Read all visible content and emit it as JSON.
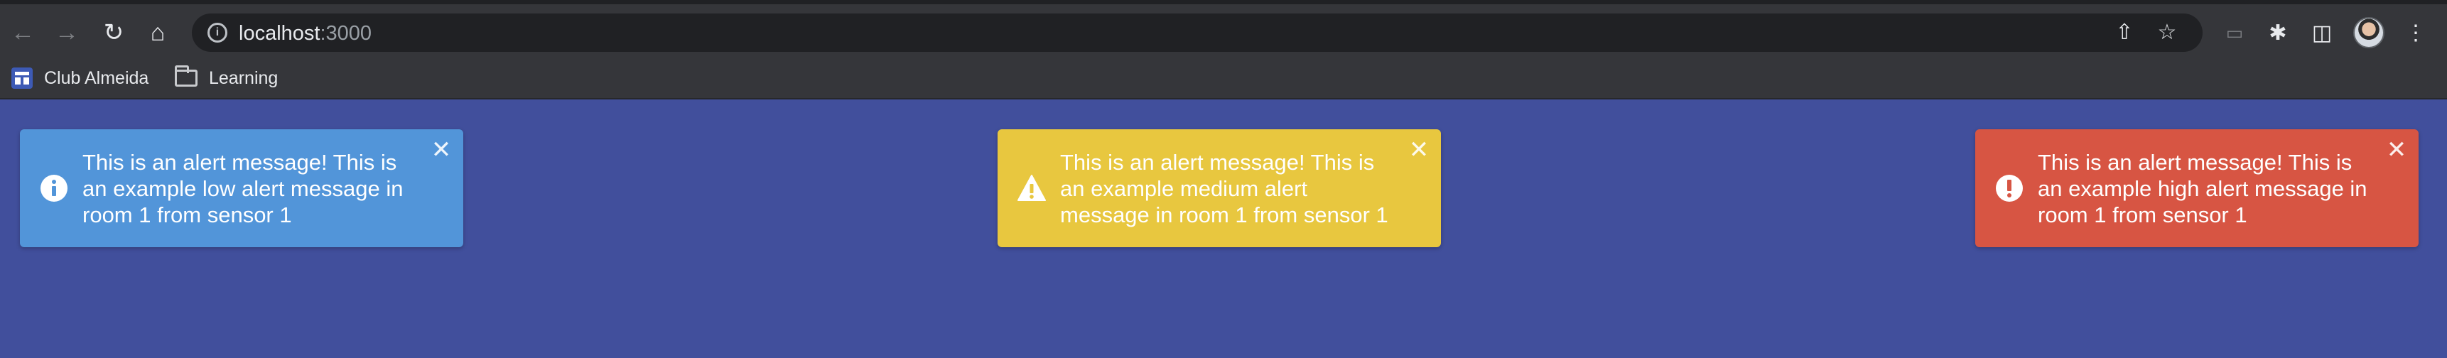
{
  "browser": {
    "url_host": "localhost",
    "url_port": ":3000",
    "bookmarks": [
      {
        "label": "Club Almeida"
      },
      {
        "label": "Learning"
      }
    ]
  },
  "alerts": [
    {
      "level": "low",
      "color": "#5295d9",
      "icon": "info-icon",
      "message": "This is an alert message! This is an example low alert message in room 1 from sensor 1",
      "close": "✕"
    },
    {
      "level": "medium",
      "color": "#e8c73f",
      "icon": "warning-icon",
      "message": "This is an alert message! This is an example medium alert message in room 1 from sensor 1",
      "close": "✕"
    },
    {
      "level": "high",
      "color": "#d75543",
      "icon": "error-icon",
      "message": "This is an alert message! This is an example high alert message in room 1 from sensor 1",
      "close": "✕"
    }
  ],
  "colors": {
    "page_background": "#414f9c",
    "chrome_background": "#35363a"
  }
}
